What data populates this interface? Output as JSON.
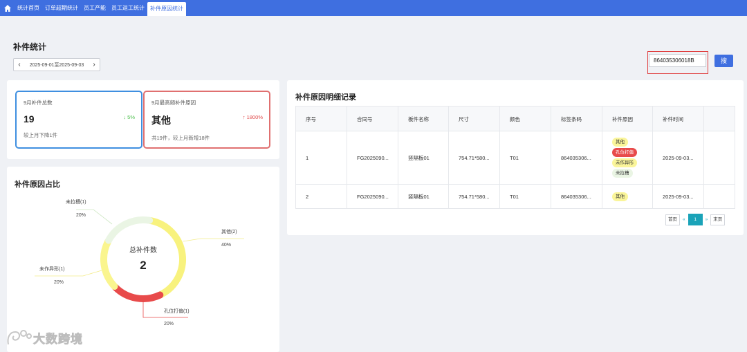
{
  "nav": {
    "tabs": [
      {
        "label": "统计首页"
      },
      {
        "label": "订单超期统计"
      },
      {
        "label": "员工产能"
      },
      {
        "label": "员工返工统计"
      },
      {
        "label": "补件原因统计"
      }
    ],
    "active_index": 4
  },
  "header": {
    "title": "补件统计",
    "date_range": "2025-09-01至2025-09-03"
  },
  "search": {
    "value": "864035306018B",
    "button_label": "搜"
  },
  "stats": [
    {
      "label": "9月补件总数",
      "value": "19",
      "trend": "↓ 5%",
      "sub": "较上月下降1件",
      "trend_color": "#4cbf4c",
      "border_color": "#3f8fe0"
    },
    {
      "label": "9月最高频补件原因",
      "value": "其他",
      "trend": "↑ 1800%",
      "sub": "共19件，较上月新增18件",
      "trend_color": "#e04848",
      "border_color": "#e07070"
    }
  ],
  "donut": {
    "title": "补件原因占比",
    "center_label": "总补件数",
    "center_value": "2",
    "segments": [
      {
        "name": "其他(2)",
        "percent": "40%",
        "share": 0.4,
        "color": "#f8f27e"
      },
      {
        "name": "孔位打偏(1)",
        "percent": "20%",
        "share": 0.2,
        "color": "#e84b4b"
      },
      {
        "name": "未作异形(1)",
        "percent": "20%",
        "share": 0.2,
        "color": "#faf58e"
      },
      {
        "name": "未拉槽(1)",
        "percent": "20%",
        "share": 0.2,
        "color": "#eaf5e4"
      }
    ]
  },
  "detail": {
    "title": "补件原因明细记录",
    "columns": [
      "序号",
      "合同号",
      "板件名称",
      "尺寸",
      "颜色",
      "标签条码",
      "补件原因",
      "补件时间"
    ],
    "rows": [
      {
        "cells": [
          "1",
          "FG2025090...",
          "竖隔板01",
          "754.71*580...",
          "T01",
          "864035306...",
          "",
          "2025-09-03..."
        ],
        "tags": [
          {
            "text": "其他",
            "bg": "#faf59a",
            "fg": "#333"
          },
          {
            "text": "孔位打偏",
            "bg": "#e84b4b",
            "fg": "#fff"
          },
          {
            "text": "未作异形",
            "bg": "#faf59a",
            "fg": "#333"
          },
          {
            "text": "未拉槽",
            "bg": "#eaf5e4",
            "fg": "#333"
          }
        ]
      },
      {
        "cells": [
          "2",
          "FG2025090...",
          "竖隔板01",
          "754.71*580...",
          "T01",
          "864035306...",
          "",
          "2025-09-03..."
        ],
        "tags": [
          {
            "text": "其他",
            "bg": "#faf59a",
            "fg": "#333"
          }
        ]
      }
    ]
  },
  "pager": {
    "first": "首页",
    "prev": "«",
    "current": "1",
    "next": "»",
    "last": "末页"
  },
  "watermark": "大数跨境"
}
